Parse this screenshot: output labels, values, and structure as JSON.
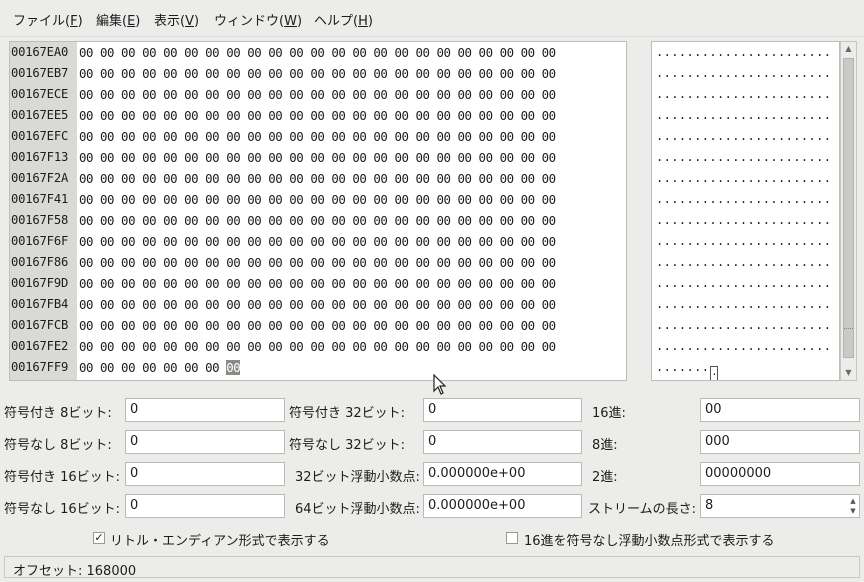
{
  "menu": [
    {
      "label": "ファイル(",
      "acc": "F",
      "tail": ")"
    },
    {
      "label": "編集(",
      "acc": "E",
      "tail": ")"
    },
    {
      "label": "表示(",
      "acc": "V",
      "tail": ")"
    },
    {
      "label": "ウィンドウ(",
      "acc": "W",
      "tail": ")"
    },
    {
      "label": "ヘルプ(",
      "acc": "H",
      "tail": ")"
    }
  ],
  "hex": {
    "rows": [
      {
        "offset": "00167EA0",
        "bytes": "00 00 00 00 00 00 00 00 00 00 00 00 00 00 00 00 00 00 00 00 00 00 00"
      },
      {
        "offset": "00167EB7",
        "bytes": "00 00 00 00 00 00 00 00 00 00 00 00 00 00 00 00 00 00 00 00 00 00 00"
      },
      {
        "offset": "00167ECE",
        "bytes": "00 00 00 00 00 00 00 00 00 00 00 00 00 00 00 00 00 00 00 00 00 00 00"
      },
      {
        "offset": "00167EE5",
        "bytes": "00 00 00 00 00 00 00 00 00 00 00 00 00 00 00 00 00 00 00 00 00 00 00"
      },
      {
        "offset": "00167EFC",
        "bytes": "00 00 00 00 00 00 00 00 00 00 00 00 00 00 00 00 00 00 00 00 00 00 00"
      },
      {
        "offset": "00167F13",
        "bytes": "00 00 00 00 00 00 00 00 00 00 00 00 00 00 00 00 00 00 00 00 00 00 00"
      },
      {
        "offset": "00167F2A",
        "bytes": "00 00 00 00 00 00 00 00 00 00 00 00 00 00 00 00 00 00 00 00 00 00 00"
      },
      {
        "offset": "00167F41",
        "bytes": "00 00 00 00 00 00 00 00 00 00 00 00 00 00 00 00 00 00 00 00 00 00 00"
      },
      {
        "offset": "00167F58",
        "bytes": "00 00 00 00 00 00 00 00 00 00 00 00 00 00 00 00 00 00 00 00 00 00 00"
      },
      {
        "offset": "00167F6F",
        "bytes": "00 00 00 00 00 00 00 00 00 00 00 00 00 00 00 00 00 00 00 00 00 00 00"
      },
      {
        "offset": "00167F86",
        "bytes": "00 00 00 00 00 00 00 00 00 00 00 00 00 00 00 00 00 00 00 00 00 00 00"
      },
      {
        "offset": "00167F9D",
        "bytes": "00 00 00 00 00 00 00 00 00 00 00 00 00 00 00 00 00 00 00 00 00 00 00"
      },
      {
        "offset": "00167FB4",
        "bytes": "00 00 00 00 00 00 00 00 00 00 00 00 00 00 00 00 00 00 00 00 00 00 00"
      },
      {
        "offset": "00167FCB",
        "bytes": "00 00 00 00 00 00 00 00 00 00 00 00 00 00 00 00 00 00 00 00 00 00 00"
      },
      {
        "offset": "00167FE2",
        "bytes": "00 00 00 00 00 00 00 00 00 00 00 00 00 00 00 00 00 00 00 00 00 00 00"
      },
      {
        "offset": "00167FF9",
        "bytes": "00 00 00 00 00 00 00 ",
        "cursor_byte": "00"
      }
    ]
  },
  "ascii": {
    "rows": [
      ".......................",
      ".......................",
      ".......................",
      ".......................",
      ".......................",
      ".......................",
      ".......................",
      ".......................",
      ".......................",
      ".......................",
      ".......................",
      ".......................",
      ".......................",
      ".......................",
      "......................."
    ],
    "last_row": ".......",
    "last_cursor": "."
  },
  "fields": {
    "s8_label": "符号付き 8ビット:",
    "s8_value": "0",
    "u8_label": "符号なし 8ビット:",
    "u8_value": "0",
    "s16_label": "符号付き 16ビット:",
    "s16_value": "0",
    "u16_label": "符号なし 16ビット:",
    "u16_value": "0",
    "s32_label": "符号付き 32ビット:",
    "s32_value": "0",
    "u32_label": "符号なし 32ビット:",
    "u32_value": "0",
    "f32_label": "32ビット浮動小数点:",
    "f32_value": "0.000000e+00",
    "f64_label": "64ビット浮動小数点:",
    "f64_value": "0.000000e+00",
    "hex_label": "16進:",
    "hex_value": "00",
    "oct_label": "8進:",
    "oct_value": "000",
    "bin_label": "2進:",
    "bin_value": "00000000",
    "stream_label": "ストリームの長さ:",
    "stream_value": "8"
  },
  "options": {
    "little_endian_label": "リトル・エンディアン形式で表示する",
    "little_endian_checked": true,
    "unsigned_hex_float_label": "16進を符号なし浮動小数点形式で表示する",
    "unsigned_hex_float_checked": false
  },
  "status": {
    "offset_text": "オフセット: 168000"
  }
}
